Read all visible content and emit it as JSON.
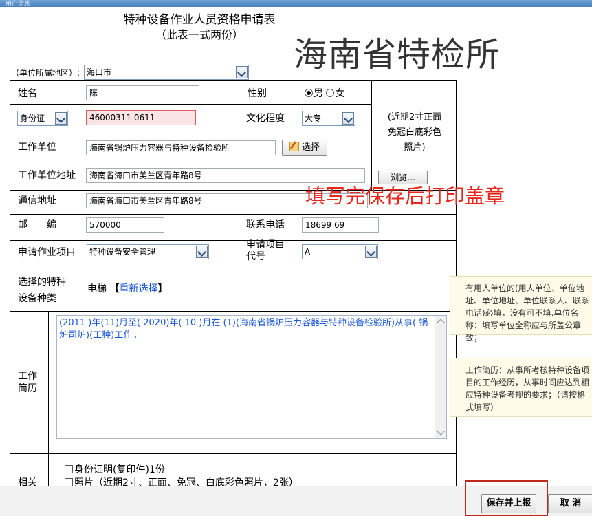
{
  "window": {
    "title": "用户信息"
  },
  "form": {
    "title": "特种设备作业人员资格申请表",
    "subtitle": "（此表一式两份）",
    "region_label": "（单位所属地区）:",
    "region_value": "海口市"
  },
  "watermark": "海南省特检所",
  "overlay_note": "填写完保存后打印盖章",
  "fields": {
    "name_label": "姓名",
    "name_value": "陈",
    "gender_label": "性别",
    "gender_male": "男",
    "gender_female": "女",
    "id_type": "身份证",
    "id_value": "46000311   0611",
    "education_label": "文化程度",
    "education_value": "大专",
    "employer_label": "工作单位",
    "employer_value": "海南省锅炉压力容器与特种设备检验所",
    "select_button": "选择",
    "employer_address_label": "工作单位地址",
    "employer_address_value": "海南省海口市美兰区青年路8号",
    "browse_button": "浏览...",
    "mail_address_label": "通信地址",
    "mail_address_value": "海南省海口市美兰区青年路8号",
    "postcode_label": "邮　　编",
    "postcode_value": "570000",
    "phone_label": "联系电话",
    "phone_value": "18699  69",
    "project_label": "申请作业项目",
    "project_value": "特种设备安全管理",
    "project_code_label_1": "申请项目",
    "project_code_label_2": "代号",
    "project_code_value": "A",
    "equipment_label_1": "选择的特种",
    "equipment_label_2": "设备种类",
    "equipment_value": "电梯",
    "reselect_open": "【",
    "reselect_link": "重新选择",
    "reselect_close": "】",
    "history_label_1": "工作",
    "history_label_2": "简历",
    "history_value": "(2011 )年(11)月至( 2020)年( 10 )月在 (1)(海南省锅炉压力容器与特种设备检验所)从事( 锅炉司炉)(工种)工作 。",
    "attachments_label": "相关",
    "attachment_1": "身份证明(复印件)1份",
    "attachment_2": "照片（近期2寸、正面、免冠、白底彩色照片，2张）"
  },
  "photo": {
    "line1": "(近期2寸正面",
    "line2": "免冠白底彩色",
    "line3": "照片)"
  },
  "tips": {
    "employer_tip": "有用人单位的(用人单位、单位地址、单位地址、单位联系人、联系电话)必填，没有可不填.单位名称：填写单位全称应与所盖公章一致；",
    "history_tip": "工作简历：从事所考核特种设备项目的工作经历，从事时间应达到相应特种设备考规的要求；（请按格式填写）"
  },
  "buttons": {
    "save_submit": "保存并上报",
    "cancel": "取 消"
  }
}
